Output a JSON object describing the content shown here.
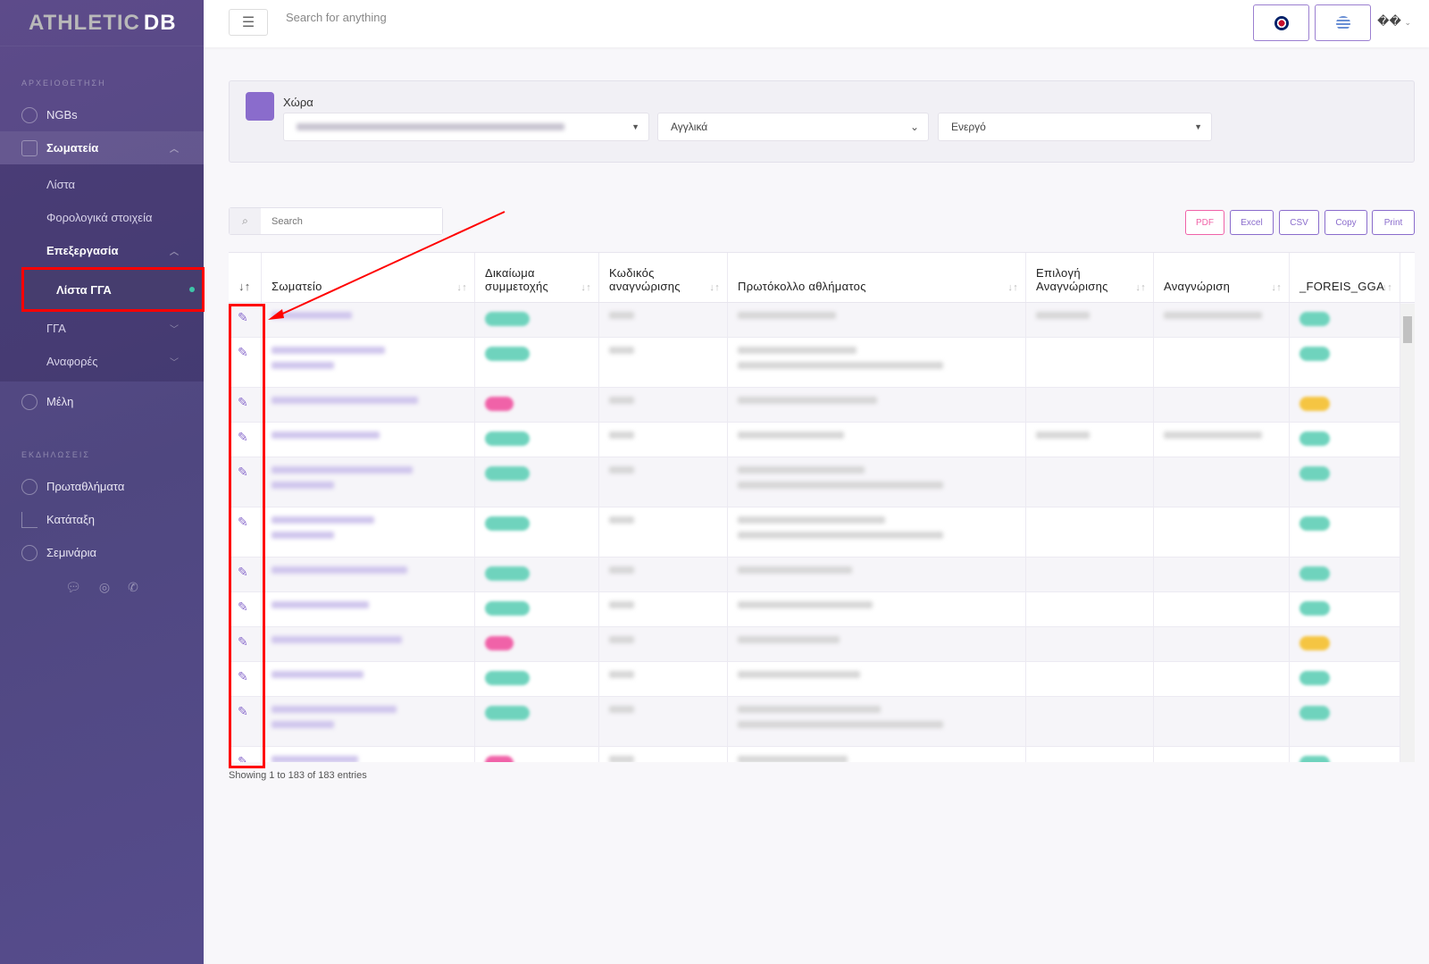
{
  "sidebar": {
    "logo": {
      "part1": "ATHLETIC",
      "part2": "DB"
    },
    "section1": "ΑΡΧΕΙΟΘΕΤΗΣΗ",
    "ngbs": "NGBs",
    "clubs": "Σωματεία",
    "clubs_sub": {
      "list": "Λίστα",
      "tax": "Φορολογικά στοιχεία",
      "processing": "Επεξεργασία",
      "gga_list": "Λίστα ΓΓΑ",
      "gga": "ΓΓΑ",
      "reports": "Αναφορές"
    },
    "members": "Μέλη",
    "section2": "ΕΚΔΗΛΩΣΕΙΣ",
    "championships": "Πρωταθλήματα",
    "ranking": "Κατάταξη",
    "seminars": "Σεμινάρια"
  },
  "header": {
    "search_placeholder": "Search for anything",
    "user": "��"
  },
  "filters": {
    "label": "Χώρα",
    "country": "",
    "language": "Αγγλικά",
    "status": "Ενεργό"
  },
  "toolbar": {
    "search_placeholder": "Search",
    "pdf": "PDF",
    "excel": "Excel",
    "csv": "CSV",
    "copy": "Copy",
    "print": "Print"
  },
  "table": {
    "columns": [
      "Σωματείο",
      "Δικαίωμα συμμετοχής",
      "Κωδικός αναγνώρισης",
      "Πρωτόκολλο αθλήματος",
      "Επιλογή Αναγνώρισης",
      "Αναγνώριση",
      "_FOREIS_GGA"
    ],
    "rows": [
      {
        "right": "yes",
        "foreis": "yes"
      },
      {
        "right": "yes",
        "foreis": "yes"
      },
      {
        "right": "no",
        "foreis": "no"
      },
      {
        "right": "yes",
        "foreis": "yes"
      },
      {
        "right": "yes",
        "foreis": "yes"
      },
      {
        "right": "yes",
        "foreis": "yes"
      },
      {
        "right": "yes",
        "foreis": "yes"
      },
      {
        "right": "yes",
        "foreis": "yes"
      },
      {
        "right": "no",
        "foreis": "no"
      },
      {
        "right": "yes",
        "foreis": "yes"
      },
      {
        "right": "yes",
        "foreis": "yes"
      },
      {
        "right": "no",
        "foreis": "yes"
      }
    ],
    "info": "Showing 1 to 183 of 183 entries"
  },
  "colors": {
    "accent": "#8a6ccc",
    "yes": "#6fd3bd",
    "no": "#f062a8",
    "foreis_no": "#f5c542",
    "annotation": "#ff0000"
  }
}
